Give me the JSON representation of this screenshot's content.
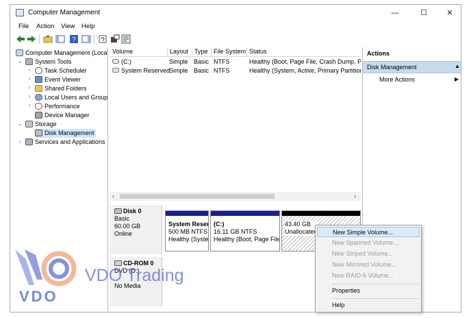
{
  "window": {
    "title": "Computer Management",
    "minimize": "—",
    "maximize": "☐",
    "close": "✕"
  },
  "menu": [
    "File",
    "Action",
    "View",
    "Help"
  ],
  "tree": {
    "root": "Computer Management (Local",
    "system_tools": "System Tools",
    "task_scheduler": "Task Scheduler",
    "event_viewer": "Event Viewer",
    "shared_folders": "Shared Folders",
    "local_users": "Local Users and Groups",
    "performance": "Performance",
    "device_manager": "Device Manager",
    "storage": "Storage",
    "disk_management": "Disk Management",
    "services": "Services and Applications"
  },
  "volume_table": {
    "headers": [
      "Volume",
      "Layout",
      "Type",
      "File System",
      "Status"
    ],
    "rows": [
      [
        "(C:)",
        "Simple",
        "Basic",
        "NTFS",
        "Healthy (Boot, Page File, Crash Dump, Prir"
      ],
      [
        "System Reserved",
        "Simple",
        "Basic",
        "NTFS",
        "Healthy (System, Active, Primary Partition)"
      ]
    ]
  },
  "disk0": {
    "name": "Disk 0",
    "type": "Basic",
    "size": "60.00 GB",
    "state": "Online",
    "partitions": [
      {
        "name": "System Reser",
        "size": "500 MB NTFS",
        "status": "Healthy (Syste"
      },
      {
        "name": "(C:)",
        "size": "16.11 GB NTFS",
        "status": "Healthy (Boot, Page File"
      },
      {
        "name": "",
        "size": "43.40 GB",
        "status": "Unallocated"
      }
    ]
  },
  "cdrom0": {
    "name": "CD-ROM 0",
    "type": "DVD (D:)",
    "state": "No Media"
  },
  "actions": {
    "header": "Actions",
    "section": "Disk Management",
    "more": "More Actions",
    "collapse_arrow": "▲",
    "more_arrow": "▶"
  },
  "context_menu": {
    "items": [
      "New Simple Volume...",
      "New Spanned Volume...",
      "New Striped Volume...",
      "New Mirrored Volume...",
      "New RAID-5 Volume..."
    ],
    "properties": "Properties",
    "help": "Help"
  },
  "watermark": {
    "brand": "VDO Trading",
    "logo_text": "VDO"
  },
  "colors": {
    "partition_bar": "#1b1f8c",
    "unallocated_bar": "#000000",
    "selection": "#cce8ff",
    "actions_section": "#c6dcee",
    "watermark": "#5a6fd0"
  }
}
